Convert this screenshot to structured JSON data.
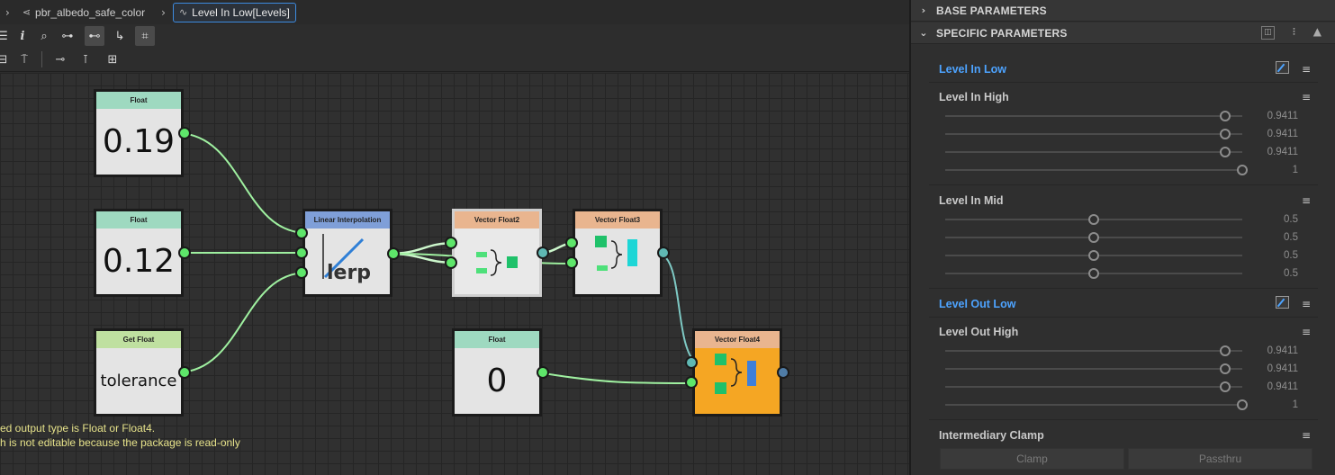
{
  "breadcrumb": {
    "items": [
      {
        "label": "pbr_albedo_safe_color",
        "icon": "graph-icon"
      },
      {
        "label": "Level In Low[Levels]",
        "icon": "function-icon"
      }
    ]
  },
  "nodes": {
    "float1": {
      "header": "Float",
      "value": "0.19"
    },
    "float2": {
      "header": "Float",
      "value": "0.12"
    },
    "getfloat": {
      "header": "Get Float",
      "value": "tolerance"
    },
    "lerp": {
      "header": "Linear Interpolation",
      "value": "lerp"
    },
    "vf2": {
      "header": "Vector Float2"
    },
    "vf3": {
      "header": "Vector Float3"
    },
    "float3": {
      "header": "Float",
      "value": "0"
    },
    "vf4": {
      "header": "Vector Float4"
    }
  },
  "status": {
    "line1": "ed output type is Float or Float4.",
    "line2": "h is not editable because the package is read-only"
  },
  "panel": {
    "base_title": "BASE PARAMETERS",
    "specific_title": "SPECIFIC PARAMETERS",
    "params": {
      "level_in_low": {
        "label": "Level In Low"
      },
      "level_in_high": {
        "label": "Level In High",
        "values": [
          "0.9411",
          "0.9411",
          "0.9411",
          "1"
        ],
        "levels": [
          0.9411,
          0.9411,
          0.9411,
          1
        ]
      },
      "level_in_mid": {
        "label": "Level In Mid",
        "values": [
          "0.5",
          "0.5",
          "0.5",
          "0.5"
        ],
        "levels": [
          0.5,
          0.5,
          0.5,
          0.5
        ]
      },
      "level_out_low": {
        "label": "Level Out Low"
      },
      "level_out_high": {
        "label": "Level Out High",
        "values": [
          "0.9411",
          "0.9411",
          "0.9411",
          "1"
        ],
        "levels": [
          0.9411,
          0.9411,
          0.9411,
          1
        ]
      },
      "intermediary_clamp": {
        "label": "Intermediary Clamp",
        "options": [
          "Clamp",
          "Passthru"
        ]
      }
    }
  },
  "colors": {
    "accent_blue": "#4da3ff",
    "wire_green": "#9ff0a0",
    "wire_cyan": "#7ec9c4",
    "node_orange": "#f5a623",
    "head_float": "#9ed9c0",
    "head_get": "#bfe0a0",
    "head_lerp": "#7f9fd8",
    "head_vector": "#e9b58f"
  }
}
